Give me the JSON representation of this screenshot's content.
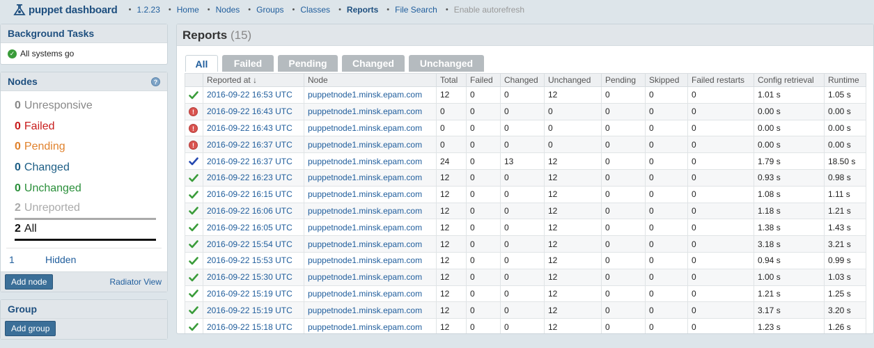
{
  "header": {
    "logo_text": "puppet dashboard",
    "version": "1.2.23",
    "nav": [
      {
        "label": "Home",
        "state": "normal"
      },
      {
        "label": "Nodes",
        "state": "normal"
      },
      {
        "label": "Groups",
        "state": "normal"
      },
      {
        "label": "Classes",
        "state": "normal"
      },
      {
        "label": "Reports",
        "state": "active"
      },
      {
        "label": "File Search",
        "state": "normal"
      },
      {
        "label": "Enable autorefresh",
        "state": "disabled"
      }
    ]
  },
  "sidebar": {
    "background_tasks": {
      "title": "Background Tasks",
      "status": "All systems go"
    },
    "nodes": {
      "title": "Nodes",
      "stats": [
        {
          "count": "0",
          "label": "Unresponsive",
          "kind": "unresponsive"
        },
        {
          "count": "0",
          "label": "Failed",
          "kind": "failed"
        },
        {
          "count": "0",
          "label": "Pending",
          "kind": "pending"
        },
        {
          "count": "0",
          "label": "Changed",
          "kind": "changed"
        },
        {
          "count": "0",
          "label": "Unchanged",
          "kind": "unchanged"
        },
        {
          "count": "2",
          "label": "Unreported",
          "kind": "unreported"
        },
        {
          "count": "2",
          "label": "All",
          "kind": "all"
        }
      ],
      "hidden": {
        "count": "1",
        "label": "Hidden"
      },
      "add_button": "Add node",
      "radiator_link": "Radiator View"
    },
    "group": {
      "title": "Group",
      "add_button": "Add group"
    }
  },
  "reports": {
    "title": "Reports",
    "count": "(15)",
    "tabs": [
      "All",
      "Failed",
      "Pending",
      "Changed",
      "Unchanged"
    ],
    "columns": [
      "",
      "Reported at ↓",
      "Node",
      "Total",
      "Failed",
      "Changed",
      "Unchanged",
      "Pending",
      "Skipped",
      "Failed restarts",
      "Config retrieval",
      "Runtime"
    ],
    "rows": [
      {
        "status": "unchanged",
        "reported_at": "2016-09-22 16:53 UTC",
        "node": "puppetnode1.minsk.epam.com",
        "total": "12",
        "failed": "0",
        "changed": "0",
        "unchanged": "12",
        "pending": "0",
        "skipped": "0",
        "failed_restarts": "0",
        "config_retrieval": "1.01 s",
        "runtime": "1.05 s"
      },
      {
        "status": "failed",
        "reported_at": "2016-09-22 16:43 UTC",
        "node": "puppetnode1.minsk.epam.com",
        "total": "0",
        "failed": "0",
        "changed": "0",
        "unchanged": "0",
        "pending": "0",
        "skipped": "0",
        "failed_restarts": "0",
        "config_retrieval": "0.00 s",
        "runtime": "0.00 s"
      },
      {
        "status": "failed",
        "reported_at": "2016-09-22 16:43 UTC",
        "node": "puppetnode1.minsk.epam.com",
        "total": "0",
        "failed": "0",
        "changed": "0",
        "unchanged": "0",
        "pending": "0",
        "skipped": "0",
        "failed_restarts": "0",
        "config_retrieval": "0.00 s",
        "runtime": "0.00 s"
      },
      {
        "status": "failed",
        "reported_at": "2016-09-22 16:37 UTC",
        "node": "puppetnode1.minsk.epam.com",
        "total": "0",
        "failed": "0",
        "changed": "0",
        "unchanged": "0",
        "pending": "0",
        "skipped": "0",
        "failed_restarts": "0",
        "config_retrieval": "0.00 s",
        "runtime": "0.00 s"
      },
      {
        "status": "changed",
        "reported_at": "2016-09-22 16:37 UTC",
        "node": "puppetnode1.minsk.epam.com",
        "total": "24",
        "failed": "0",
        "changed": "13",
        "unchanged": "12",
        "pending": "0",
        "skipped": "0",
        "failed_restarts": "0",
        "config_retrieval": "1.79 s",
        "runtime": "18.50 s"
      },
      {
        "status": "unchanged",
        "reported_at": "2016-09-22 16:23 UTC",
        "node": "puppetnode1.minsk.epam.com",
        "total": "12",
        "failed": "0",
        "changed": "0",
        "unchanged": "12",
        "pending": "0",
        "skipped": "0",
        "failed_restarts": "0",
        "config_retrieval": "0.93 s",
        "runtime": "0.98 s"
      },
      {
        "status": "unchanged",
        "reported_at": "2016-09-22 16:15 UTC",
        "node": "puppetnode1.minsk.epam.com",
        "total": "12",
        "failed": "0",
        "changed": "0",
        "unchanged": "12",
        "pending": "0",
        "skipped": "0",
        "failed_restarts": "0",
        "config_retrieval": "1.08 s",
        "runtime": "1.11 s"
      },
      {
        "status": "unchanged",
        "reported_at": "2016-09-22 16:06 UTC",
        "node": "puppetnode1.minsk.epam.com",
        "total": "12",
        "failed": "0",
        "changed": "0",
        "unchanged": "12",
        "pending": "0",
        "skipped": "0",
        "failed_restarts": "0",
        "config_retrieval": "1.18 s",
        "runtime": "1.21 s"
      },
      {
        "status": "unchanged",
        "reported_at": "2016-09-22 16:05 UTC",
        "node": "puppetnode1.minsk.epam.com",
        "total": "12",
        "failed": "0",
        "changed": "0",
        "unchanged": "12",
        "pending": "0",
        "skipped": "0",
        "failed_restarts": "0",
        "config_retrieval": "1.38 s",
        "runtime": "1.43 s"
      },
      {
        "status": "unchanged",
        "reported_at": "2016-09-22 15:54 UTC",
        "node": "puppetnode1.minsk.epam.com",
        "total": "12",
        "failed": "0",
        "changed": "0",
        "unchanged": "12",
        "pending": "0",
        "skipped": "0",
        "failed_restarts": "0",
        "config_retrieval": "3.18 s",
        "runtime": "3.21 s"
      },
      {
        "status": "unchanged",
        "reported_at": "2016-09-22 15:53 UTC",
        "node": "puppetnode1.minsk.epam.com",
        "total": "12",
        "failed": "0",
        "changed": "0",
        "unchanged": "12",
        "pending": "0",
        "skipped": "0",
        "failed_restarts": "0",
        "config_retrieval": "0.94 s",
        "runtime": "0.99 s"
      },
      {
        "status": "unchanged",
        "reported_at": "2016-09-22 15:30 UTC",
        "node": "puppetnode1.minsk.epam.com",
        "total": "12",
        "failed": "0",
        "changed": "0",
        "unchanged": "12",
        "pending": "0",
        "skipped": "0",
        "failed_restarts": "0",
        "config_retrieval": "1.00 s",
        "runtime": "1.03 s"
      },
      {
        "status": "unchanged",
        "reported_at": "2016-09-22 15:19 UTC",
        "node": "puppetnode1.minsk.epam.com",
        "total": "12",
        "failed": "0",
        "changed": "0",
        "unchanged": "12",
        "pending": "0",
        "skipped": "0",
        "failed_restarts": "0",
        "config_retrieval": "1.21 s",
        "runtime": "1.25 s"
      },
      {
        "status": "unchanged",
        "reported_at": "2016-09-22 15:19 UTC",
        "node": "puppetnode1.minsk.epam.com",
        "total": "12",
        "failed": "0",
        "changed": "0",
        "unchanged": "12",
        "pending": "0",
        "skipped": "0",
        "failed_restarts": "0",
        "config_retrieval": "3.17 s",
        "runtime": "3.20 s"
      },
      {
        "status": "unchanged",
        "reported_at": "2016-09-22 15:18 UTC",
        "node": "puppetnode1.minsk.epam.com",
        "total": "12",
        "failed": "0",
        "changed": "0",
        "unchanged": "12",
        "pending": "0",
        "skipped": "0",
        "failed_restarts": "0",
        "config_retrieval": "1.23 s",
        "runtime": "1.26 s"
      }
    ]
  },
  "colors": {
    "brand": "#1e4f7f",
    "link": "#1f5d9c",
    "failed": "#c81d1d",
    "pending": "#e0822d",
    "changed": "#1d5e85",
    "unchanged": "#2a8f3a"
  },
  "icons": {
    "unchanged": "green-check-icon",
    "changed": "blue-check-icon",
    "failed": "red-exclamation-icon"
  }
}
